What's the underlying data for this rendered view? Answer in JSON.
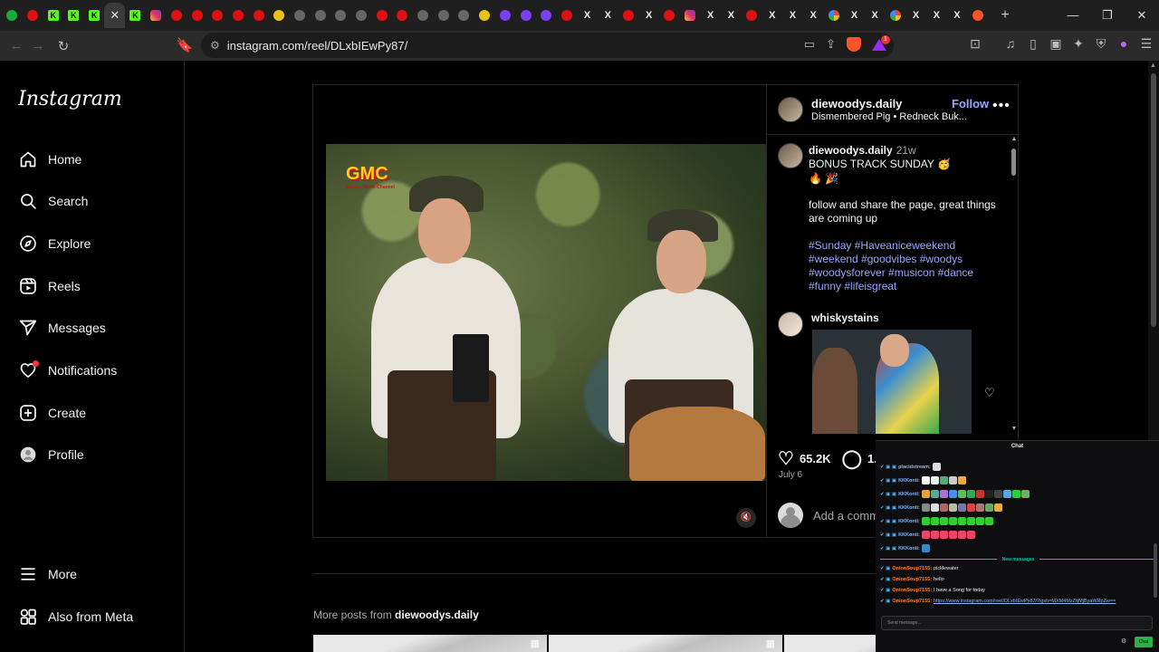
{
  "browser": {
    "tabs": [
      {
        "kind": "gn",
        "glyph": ""
      },
      {
        "kind": "yt",
        "glyph": ""
      },
      {
        "kind": "k",
        "glyph": "K"
      },
      {
        "kind": "k",
        "glyph": "K"
      },
      {
        "kind": "k",
        "glyph": "K"
      },
      {
        "kind": "close",
        "glyph": "✕",
        "active": true
      },
      {
        "kind": "k",
        "glyph": "K"
      },
      {
        "kind": "ig",
        "glyph": ""
      },
      {
        "kind": "yt",
        "glyph": ""
      },
      {
        "kind": "yt",
        "glyph": ""
      },
      {
        "kind": "yt",
        "glyph": ""
      },
      {
        "kind": "yt",
        "glyph": ""
      },
      {
        "kind": "yt",
        "glyph": ""
      },
      {
        "kind": "ye",
        "glyph": ""
      },
      {
        "kind": "gr",
        "glyph": ""
      },
      {
        "kind": "gr",
        "glyph": ""
      },
      {
        "kind": "gr",
        "glyph": ""
      },
      {
        "kind": "gr",
        "glyph": ""
      },
      {
        "kind": "yt",
        "glyph": ""
      },
      {
        "kind": "yt",
        "glyph": ""
      },
      {
        "kind": "gr",
        "glyph": ""
      },
      {
        "kind": "gr",
        "glyph": ""
      },
      {
        "kind": "gr",
        "glyph": ""
      },
      {
        "kind": "ye",
        "glyph": ""
      },
      {
        "kind": "pu",
        "glyph": ""
      },
      {
        "kind": "pu",
        "glyph": ""
      },
      {
        "kind": "pu",
        "glyph": ""
      },
      {
        "kind": "yt",
        "glyph": ""
      },
      {
        "kind": "x",
        "glyph": "X"
      },
      {
        "kind": "x",
        "glyph": "X"
      },
      {
        "kind": "yt",
        "glyph": ""
      },
      {
        "kind": "x",
        "glyph": "X"
      },
      {
        "kind": "yt",
        "glyph": ""
      },
      {
        "kind": "ig",
        "glyph": ""
      },
      {
        "kind": "x",
        "glyph": "X"
      },
      {
        "kind": "x",
        "glyph": "X"
      },
      {
        "kind": "yt",
        "glyph": ""
      },
      {
        "kind": "x",
        "glyph": "X"
      },
      {
        "kind": "x",
        "glyph": "X"
      },
      {
        "kind": "x",
        "glyph": "X"
      },
      {
        "kind": "g",
        "glyph": ""
      },
      {
        "kind": "x",
        "glyph": "X"
      },
      {
        "kind": "x",
        "glyph": "X"
      },
      {
        "kind": "g",
        "glyph": ""
      },
      {
        "kind": "x",
        "glyph": "X"
      },
      {
        "kind": "x",
        "glyph": "X"
      },
      {
        "kind": "x",
        "glyph": "X"
      },
      {
        "kind": "br",
        "glyph": ""
      }
    ],
    "url": "instagram.com/reel/DLxbIEwPy87/",
    "badge_count": "1"
  },
  "sidebar": {
    "logo": "Instagram",
    "items": [
      {
        "label": "Home",
        "icon": "home-icon"
      },
      {
        "label": "Search",
        "icon": "search-icon"
      },
      {
        "label": "Explore",
        "icon": "explore-icon"
      },
      {
        "label": "Reels",
        "icon": "reels-icon"
      },
      {
        "label": "Messages",
        "icon": "messages-icon"
      },
      {
        "label": "Notifications",
        "icon": "heart-icon"
      },
      {
        "label": "Create",
        "icon": "create-icon"
      },
      {
        "label": "Profile",
        "icon": "profile-icon"
      }
    ],
    "more": "More",
    "meta": "Also from Meta"
  },
  "post": {
    "video_logo": "GMC",
    "video_logo_sub": "Grosse Musik Channel",
    "author": "diewoodys.daily",
    "follow": "Follow",
    "audio": "Dismembered Pig • Redneck Buk...",
    "caption_author": "diewoodys.daily",
    "caption_time": "21w",
    "caption_line1": "BONUS TRACK SUNDAY 🥳",
    "caption_emojis": "🔥 🎉",
    "caption_line2": "follow and share the page, great things",
    "caption_line3": "are coming up",
    "hashtags_1": "#Sunday #Haveaniceweekend",
    "hashtags_2": "#weekend #goodvibes #woodys",
    "hashtags_3": "#woodysforever #musicon #dance",
    "hashtags_4": "#funny #lifeisgreat",
    "commenter": "whiskystains",
    "likes": "65.2K",
    "comments": "1.8K",
    "date": "July 6",
    "add_comment": "Add a comment..."
  },
  "more_posts": {
    "prefix": "More posts from",
    "user": "diewoodys.daily"
  },
  "chat": {
    "title": "Chat",
    "lines": [
      {
        "who": "placidstream:",
        "msg": "",
        "emotes": [
          "#ddd"
        ]
      },
      {
        "who": "KKKonti:",
        "msg": "",
        "emotes": [
          "#fff",
          "#eee",
          "#5a7",
          "#ccc",
          "#ea4"
        ]
      },
      {
        "who": "KKKonti:",
        "msg": "",
        "emotes": [
          "#e8a33a",
          "#5a9",
          "#a7c",
          "#4a8ee8",
          "#6b5",
          "#3a5",
          "#c33",
          "#222",
          "#444",
          "#5ad",
          "#3c3",
          "#7a6"
        ]
      },
      {
        "who": "KKKonti:",
        "msg": "",
        "emotes": [
          "#888",
          "#ddd",
          "#a66",
          "#bba",
          "#77a",
          "#d44",
          "#a77",
          "#6a6",
          "#ea4"
        ]
      },
      {
        "who": "KKKonti:",
        "msg": "",
        "emotes": [
          "#3c3",
          "#3c3",
          "#3c3",
          "#3c3",
          "#3c3",
          "#3c3",
          "#3c3",
          "#3c3"
        ]
      },
      {
        "who": "KKKonti:",
        "msg": "",
        "emotes": [
          "#e46",
          "#e46",
          "#e46",
          "#e46",
          "#e46",
          "#e46"
        ]
      },
      {
        "who": "KKKonti:",
        "msg": "",
        "emotes": [
          "#38c"
        ]
      }
    ],
    "new_messages": "New messages",
    "onion_lines": [
      {
        "who": "OnionSoup7155:",
        "msg": "picklewater"
      },
      {
        "who": "OnionSoup7155:",
        "msg": "hello"
      },
      {
        "who": "OnionSoup7155:",
        "msg": "I have a Song for today"
      },
      {
        "who": "OnionSoup7155:",
        "msg": "https://www.instagram.com/reel/DLxbIEwPy87/?igsh=MXM4MzZqMjByaWRpZw=="
      }
    ],
    "input_placeholder": "Send message...",
    "send": "Chat"
  }
}
